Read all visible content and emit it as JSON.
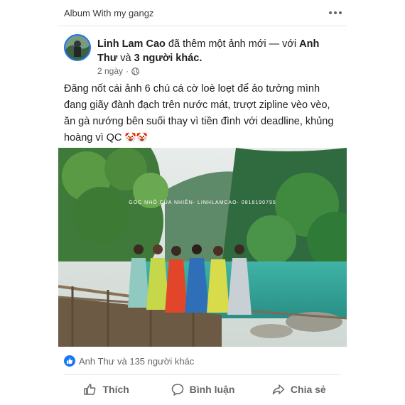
{
  "album": {
    "title": "Album With my gangz"
  },
  "post": {
    "author": "Linh Lam Cao",
    "action_text": "đã thêm một ảnh mới — với",
    "tagged": "Anh Thư",
    "and_text": "và",
    "others": "3 người khác",
    "time": "2 ngày",
    "privacy_icon": "globe-icon",
    "text": "Đăng nốt cái ảnh 6 chú cá cờ loè loẹt để ảo tưởng mình đang giãy đành đạch trên nước mát, trượt zipline vèo vèo, ăn gà nướng bên suối thay vì tiền đình với deadline, khủng hoàng vì QC",
    "emoji": "🤡🤡",
    "photo_watermark": "GÓC NHỎ CỦA NHIÊN- LINHLAMCAO- 0818190795"
  },
  "reactions": {
    "summary": "Anh Thư và 135 người khác"
  },
  "actions": {
    "like": "Thích",
    "comment": "Bình luận",
    "share": "Chia sẻ"
  },
  "colors": {
    "accent": "#1877f2",
    "secondary_text": "#65676b"
  }
}
